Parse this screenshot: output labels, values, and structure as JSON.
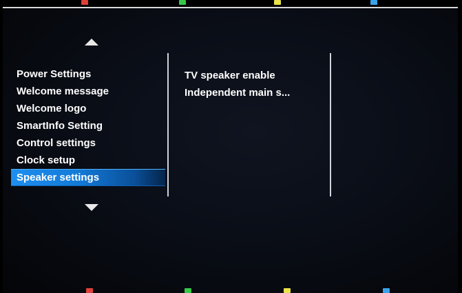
{
  "menu": {
    "items": [
      {
        "label": "Power Settings"
      },
      {
        "label": "Welcome message"
      },
      {
        "label": "Welcome logo"
      },
      {
        "label": "SmartInfo Setting"
      },
      {
        "label": "Control settings"
      },
      {
        "label": "Clock setup"
      },
      {
        "label": "Speaker settings",
        "selected": true
      }
    ]
  },
  "submenu": {
    "items": [
      {
        "label": "TV speaker enable"
      },
      {
        "label": "Independent main s..."
      }
    ]
  },
  "color_keys": {
    "red": "#e0403a",
    "green": "#37c84a",
    "yellow": "#e9e24a",
    "blue": "#3aa2ea"
  },
  "colors": {
    "selection": "#1379d6",
    "text": "#ffffff",
    "background": "#0a0e17"
  }
}
